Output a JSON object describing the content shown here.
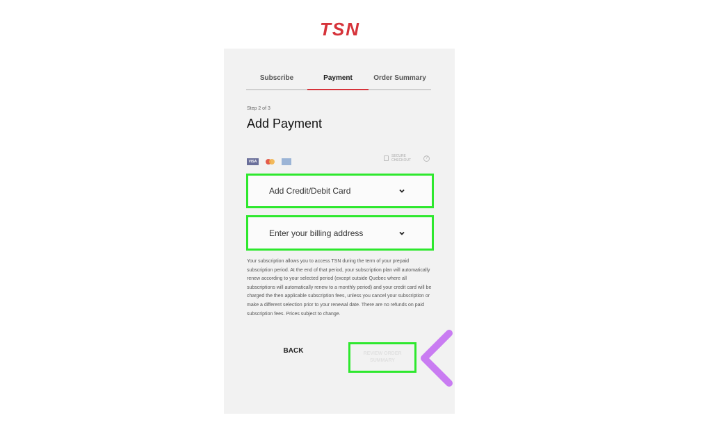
{
  "brand": {
    "logo_text": "TSN",
    "logo_color": "#d6333a"
  },
  "tabs": [
    {
      "label": "Subscribe",
      "active": false
    },
    {
      "label": "Payment",
      "active": true
    },
    {
      "label": "Order Summary",
      "active": false
    }
  ],
  "step_text": "Step 2 of 3",
  "page_title": "Add Payment",
  "payment_icons": [
    "visa-icon",
    "mastercard-icon",
    "amex-icon"
  ],
  "secure": {
    "text": "SECURE CHECKOUT",
    "icon": "lock-icon",
    "help": "?"
  },
  "dropdowns": {
    "card": {
      "label": "Add Credit/Debit Card",
      "icon": "chevron-down-icon"
    },
    "billing": {
      "label": "Enter your billing address",
      "icon": "chevron-down-icon"
    }
  },
  "notice": "Your subscription allows you to access TSN during the term of your prepaid subscription period. At the end of that period, your subscription plan will automatically renew according to your selected period (except outside Quebec where all subscriptions will automatically renew to a monthly period) and your credit card will be charged the then applicable subscription fees, unless you cancel your subscription or make a different selection prior to your renewal date. There are no refunds on paid subscription fees. Prices subject to change.",
  "buttons": {
    "back": "BACK",
    "submit": "REVIEW ORDER SUMMARY"
  },
  "colors": {
    "highlight": "#2ee82e",
    "accent": "#d6333a",
    "arrow_start": "#c97cf2",
    "arrow_end": "#7cc8f2"
  }
}
